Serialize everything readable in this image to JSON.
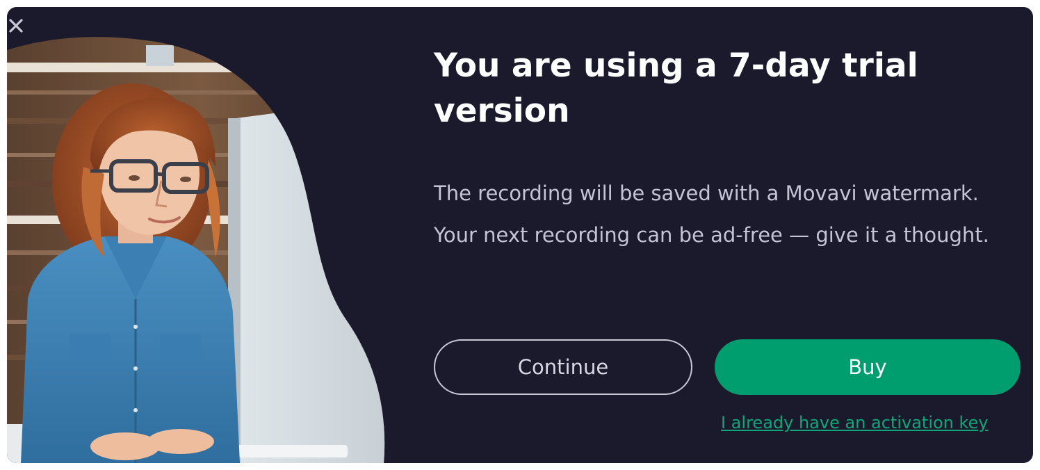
{
  "dialog": {
    "close_icon": "close-icon",
    "title": "You are using a 7-day trial version",
    "message": "The recording will be saved with a Movavi watermark. Your next recording can be ad-free — give it a thought.",
    "continue_label": "Continue",
    "buy_label": "Buy",
    "activation_link": "I already have an activation key"
  },
  "colors": {
    "background": "#1b1a2c",
    "accent": "#009d6e",
    "link": "#10a679",
    "title": "#ffffff",
    "body_text": "#c5c4d4"
  },
  "illustration": {
    "subject": "woman with glasses working at desktop computer"
  }
}
